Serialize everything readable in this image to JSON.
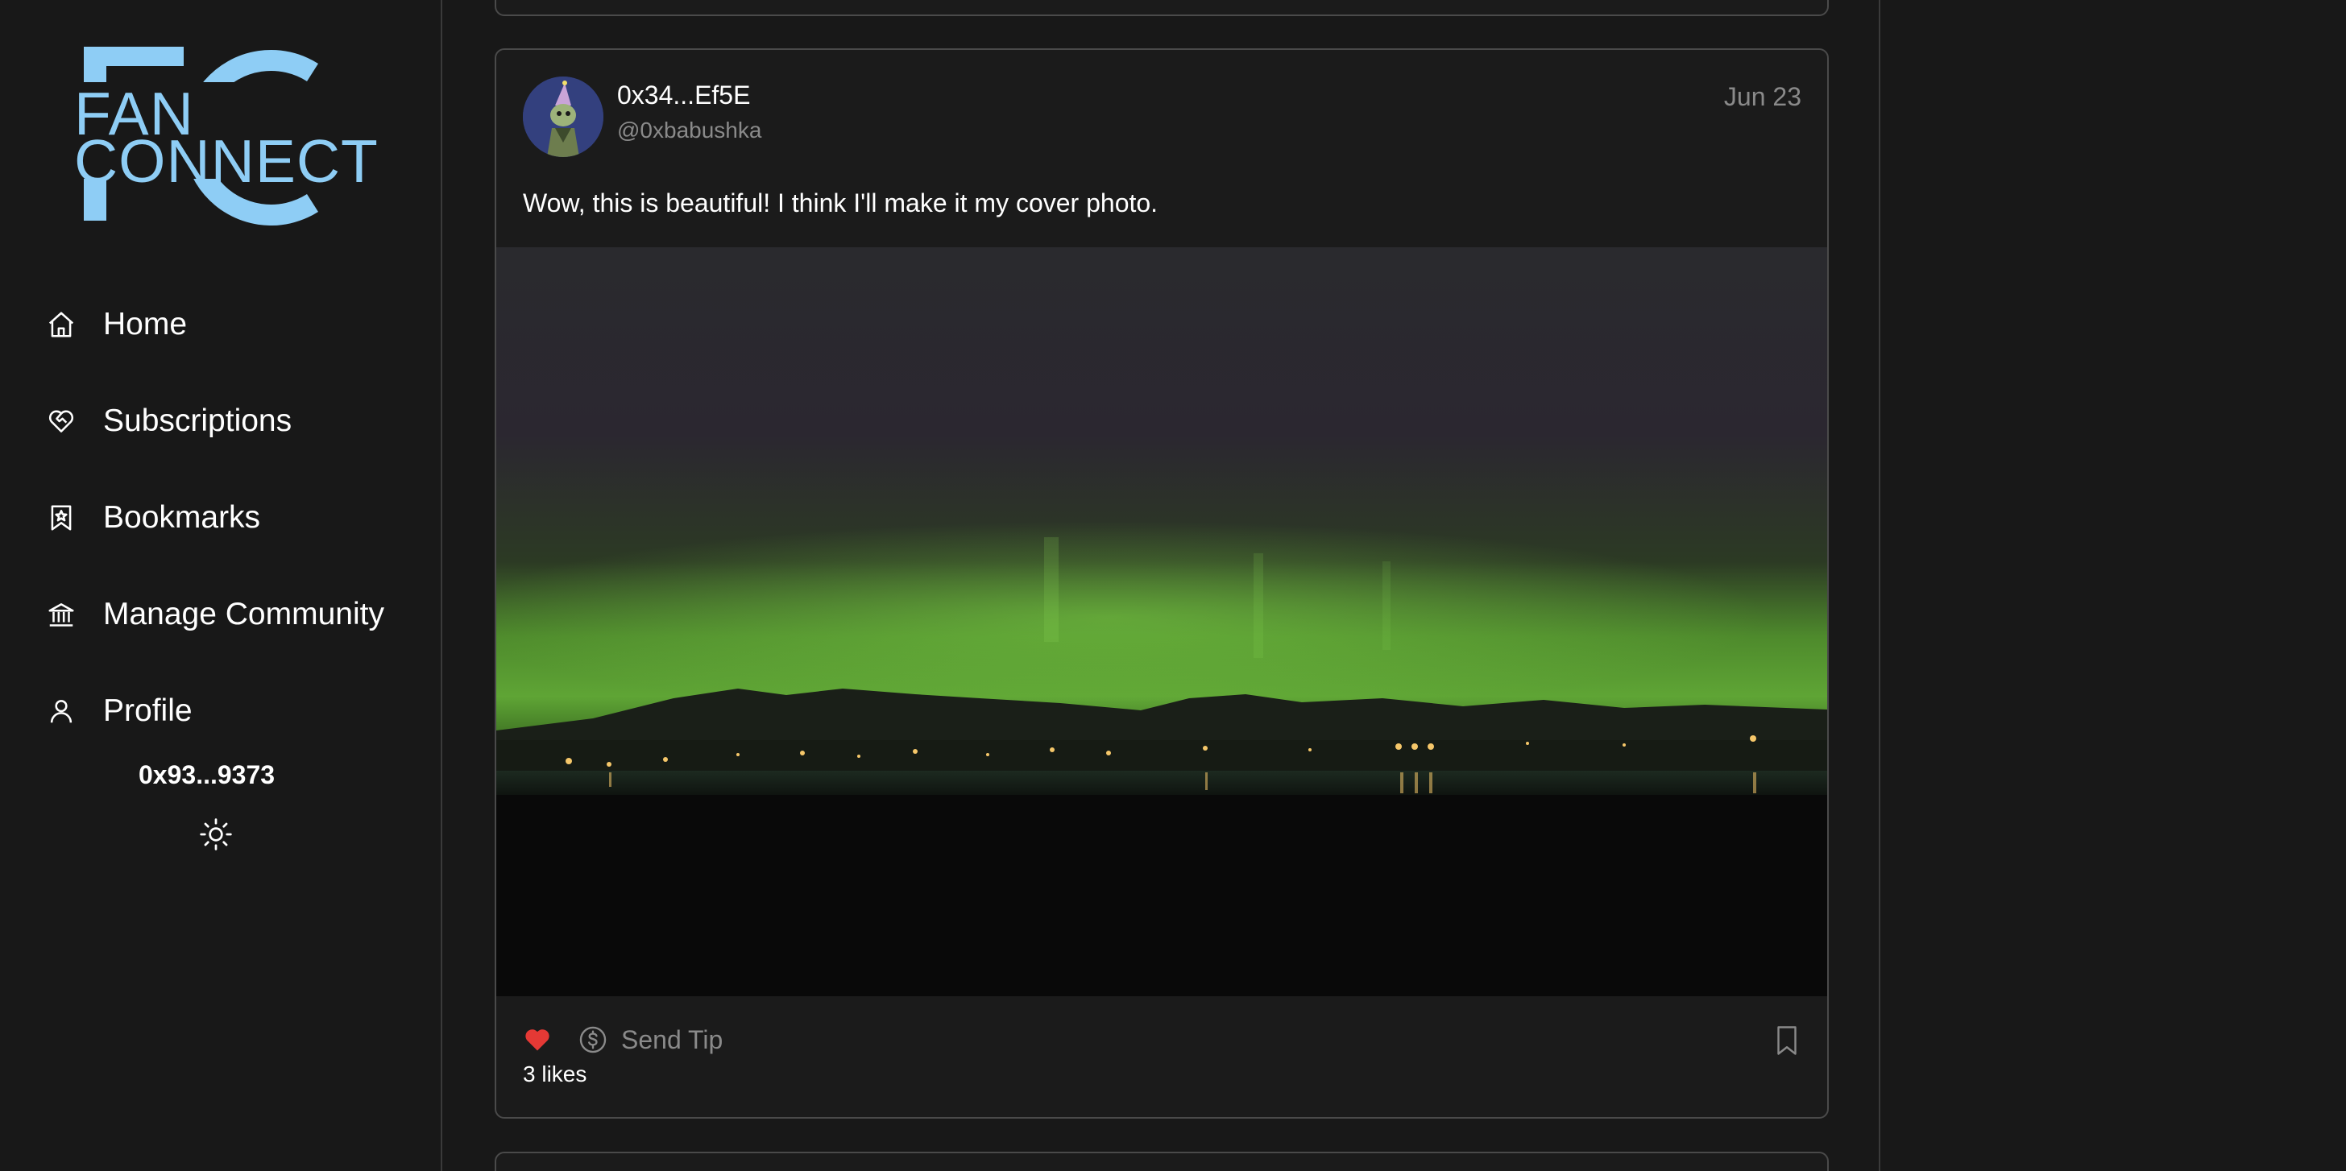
{
  "app": {
    "logo_line1": "FAN",
    "logo_line2": "CONNECT",
    "brand_color": "#8ecdf5"
  },
  "sidebar": {
    "items": [
      {
        "label": "Home",
        "icon": "home-icon"
      },
      {
        "label": "Subscriptions",
        "icon": "heart-handshake-icon"
      },
      {
        "label": "Bookmarks",
        "icon": "bookmark-star-icon"
      },
      {
        "label": "Manage Community",
        "icon": "bank-icon"
      },
      {
        "label": "Profile",
        "icon": "user-icon"
      }
    ],
    "wallet_address": "0x93...9373",
    "theme_toggle_icon": "sun-icon"
  },
  "post": {
    "author_name": "0x34...Ef5E",
    "author_handle": "@0xbabushka",
    "date": "Jun 23",
    "text": "Wow, this is beautiful! I think I'll make it my cover photo.",
    "image_subject": "aurora-over-city-bay",
    "liked": true,
    "like_color": "#e53935",
    "tip_label": "Send Tip",
    "likes_text": "3 likes"
  }
}
